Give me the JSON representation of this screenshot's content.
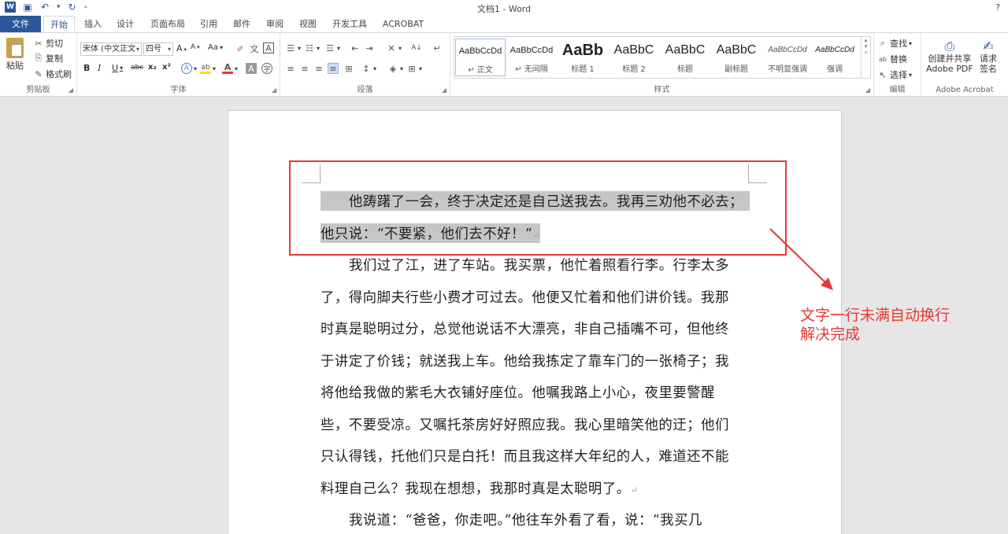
{
  "titlebar": {
    "title": "文档1 - Word",
    "help": "?"
  },
  "tabs": [
    "文件",
    "开始",
    "插入",
    "设计",
    "页面布局",
    "引用",
    "邮件",
    "审阅",
    "视图",
    "开发工具",
    "ACROBAT"
  ],
  "clipboard": {
    "paste": "粘贴",
    "cut": "剪切",
    "copy": "复制",
    "format_painter": "格式刷",
    "label": "剪贴板"
  },
  "font": {
    "name": "宋体 (中文正文",
    "size": "四号",
    "bold": "B",
    "italic": "I",
    "underline": "U",
    "strike": "abc",
    "sub": "x₂",
    "sup": "x²",
    "case": "Aa",
    "grow": "A",
    "shrink": "A",
    "label": "字体"
  },
  "paragraph": {
    "label": "段落"
  },
  "styles": {
    "label": "样式",
    "items": [
      {
        "sample": "AaBbCcDd",
        "name": "↵ 正文"
      },
      {
        "sample": "AaBbCcDd",
        "name": "↵ 无间隔"
      },
      {
        "sample": "AaBb",
        "name": "标题 1"
      },
      {
        "sample": "AaBbC",
        "name": "标题 2"
      },
      {
        "sample": "AaBbC",
        "name": "标题"
      },
      {
        "sample": "AaBbC",
        "name": "副标题"
      },
      {
        "sample": "AaBbCcDd",
        "name": "不明显强调"
      },
      {
        "sample": "AaBbCcDd",
        "name": "强调"
      }
    ]
  },
  "editing": {
    "find": "查找",
    "replace": "替换",
    "select": "选择",
    "label": "编辑"
  },
  "acrobat": {
    "create_share": "创建并共享",
    "adobe_pdf": "Adobe PDF",
    "request": "请求",
    "sign": "签名",
    "label": "Adobe Acrobat"
  },
  "document": {
    "lines": [
      "他踌躇了一会，终于决定还是自己送我去。我再三劝他不必去；",
      "他只说：“不要紧，他们去不好！”",
      "我们过了江，进了车站。我买票，他忙着照看行李。行李太多",
      "了，得向脚夫行些小费才可过去。他便又忙着和他们讲价钱。我那",
      "时真是聪明过分，总觉他说话不大漂亮，非自己插嘴不可，但他终",
      "于讲定了价钱；就送我上车。他给我拣定了靠车门的一张椅子；我",
      "将他给我做的紫毛大衣铺好座位。他嘱我路上小心，夜里要警醒",
      "些，不要受凉。又嘱托茶房好好照应我。我心里暗笑他的迂；他们",
      "只认得钱，托他们只是白托！而且我这样大年纪的人，难道还不能",
      "料理自己么？我现在想想，我那时真是太聪明了。",
      "我说道：“爸爸，你走吧。”他往车外看了看，说：“我买几"
    ],
    "pilcrow": "↵"
  },
  "annotation": {
    "line1": "文字一行未满自动换行",
    "line2": "解决完成",
    "color": "#e53935"
  }
}
